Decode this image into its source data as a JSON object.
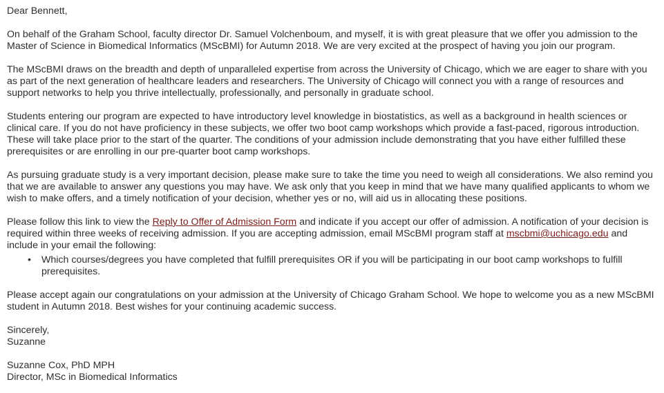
{
  "greeting": "Dear Bennett,",
  "paragraphs": {
    "p1": "On behalf of the Graham School, faculty director Dr. Samuel Volchenboum, and myself, it is with great pleasure that we offer you admission to the Master of Science in Biomedical Informatics (MScBMI) for Autumn 2018. We are very excited at the prospect of having you join our program.",
    "p2": "The MScBMI draws on the breadth and depth of unparalleled expertise from across the University of Chicago, which we are eager to share with you as part of the next generation of healthcare leaders and researchers. The University of Chicago will connect you with a range of resources and support networks to help you thrive intellectually, professionally, and personally in graduate school.",
    "p3": "Students entering our program are expected to have introductory level knowledge in biostatistics, as well as a background in health sciences or clinical care. If you do not have proficiency in these subjects, we offer two boot camp workshops which provide a fast-paced, rigorous introduction. These will take place prior to the start of the quarter. The conditions of your admission include demonstrating that you have either fulfilled these prerequisites or are enrolling in our pre-quarter boot camp workshops.",
    "p4": "As pursuing graduate study is a very important decision, please make sure to take the time you need to weigh all considerations. We also remind you that we are available to answer any questions you may have. We ask only that you keep in mind that we have many qualified applicants to whom we wish to make offers, and a timely notification of your decision, whether yes or no, will aid us in allocating these positions.",
    "p5_before_link": "Please follow this link to view the ",
    "p5_link": "Reply to Offer of Admission Form",
    "p5_middle": " and indicate if you accept our offer of admission. A notification of your decision is required within three weeks of receiving admission. If you are accepting admission, email MScBMI program staff at ",
    "p5_email": "mscbmi@uchicago.edu",
    "p5_after": " and include in your email the following:",
    "bullet": "Which courses/degrees you have completed that fulfill prerequisites OR if you will be participating in our boot camp workshops to fulfill prerequisites.",
    "bullet_marker": "•",
    "p6": "Please accept again our congratulations on your admission at the University of Chicago Graham School. We hope to welcome you as a new MScBMI student in Autumn 2018. Best wishes for your continuing academic success."
  },
  "closing": {
    "sign_off": "Sincerely,",
    "first_name": "Suzanne",
    "full_name": "Suzanne Cox, PhD MPH",
    "title": "Director, MSc in Biomedical Informatics"
  },
  "colors": {
    "text": "#2e2e2e",
    "link": "#7a1c1c"
  }
}
